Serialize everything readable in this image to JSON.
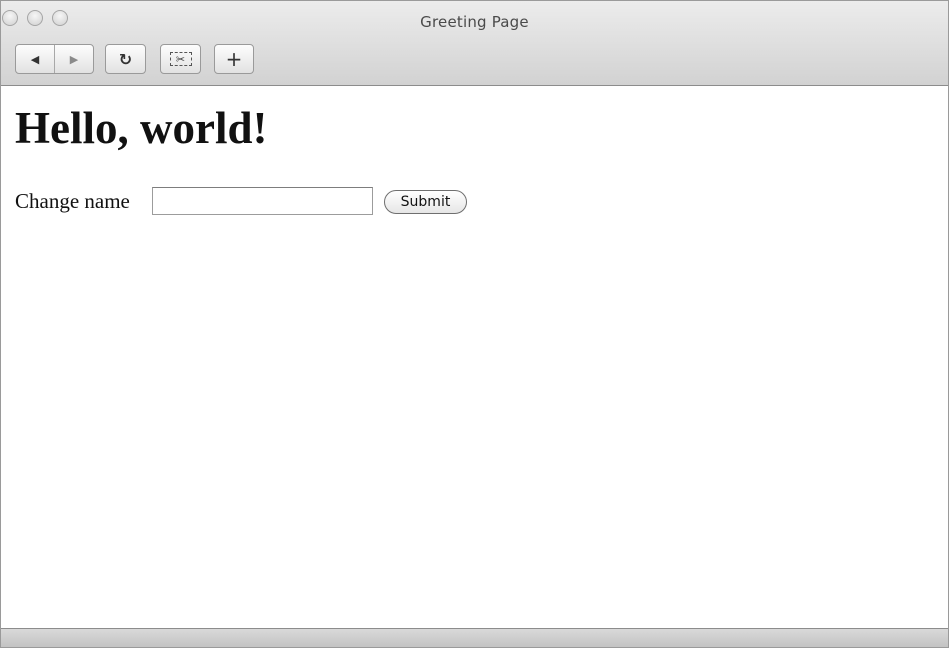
{
  "window": {
    "title": "Greeting Page"
  },
  "toolbar": {
    "back_icon": "◀",
    "forward_icon": "▶",
    "reload_icon": "↻",
    "clip_icon": "✂",
    "add_icon": "+"
  },
  "page": {
    "heading": "Hello, world!",
    "change_name_label": "Change name",
    "name_input_value": "",
    "submit_label": "Submit"
  }
}
